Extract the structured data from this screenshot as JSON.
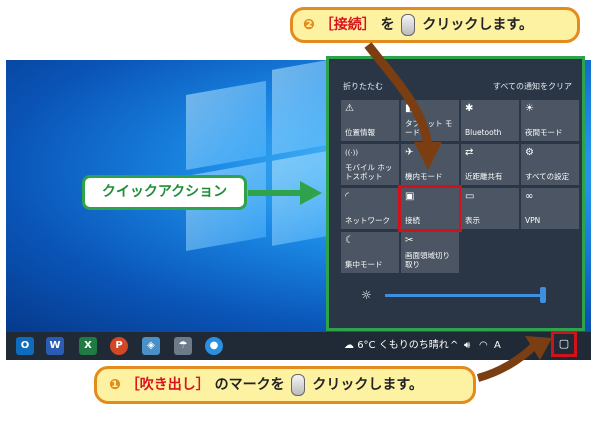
{
  "callout_top": {
    "number": "❷",
    "bracket": "［接続］",
    "text1": "を",
    "text2": "クリックします。"
  },
  "callout_bottom": {
    "number": "❶",
    "bracket": "［吹き出し］",
    "text1": "のマークを",
    "text2": "クリックします。"
  },
  "quick_action_label": "クイックアクション",
  "action_center": {
    "collapse": "折りたたむ",
    "clear_all": "すべての通知をクリア",
    "tiles": [
      {
        "icon": "⚠",
        "label": "位置情報"
      },
      {
        "icon": "◧",
        "label": "タブレット モード"
      },
      {
        "icon": "✱",
        "label": "Bluetooth"
      },
      {
        "icon": "☀",
        "label": "夜間モード"
      },
      {
        "icon": "((·))",
        "label": "モバイル ホットスポット"
      },
      {
        "icon": "✈",
        "label": "機内モード"
      },
      {
        "icon": "⇄",
        "label": "近距離共有"
      },
      {
        "icon": "⚙",
        "label": "すべての設定"
      },
      {
        "icon": "◜",
        "label": "ネットワーク"
      },
      {
        "icon": "▣",
        "label": "接続"
      },
      {
        "icon": "▭",
        "label": "表示"
      },
      {
        "icon": "∞",
        "label": "VPN"
      },
      {
        "icon": "☾",
        "label": "集中モード"
      },
      {
        "icon": "✂",
        "label": "画面領域切り取り"
      }
    ],
    "brightness_icon": "☼",
    "brightness_level": 1.0
  },
  "taskbar": {
    "apps": [
      {
        "name": "outlook",
        "glyph": "O",
        "color": "#0f6cbd"
      },
      {
        "name": "word",
        "glyph": "W",
        "color": "#2b5cb4"
      },
      {
        "name": "excel",
        "glyph": "X",
        "color": "#1f7a43"
      },
      {
        "name": "powerpoint",
        "glyph": "P",
        "color": "#d24726"
      },
      {
        "name": "app5",
        "glyph": "◈",
        "color": "#4a90c6"
      },
      {
        "name": "app6",
        "glyph": "☂",
        "color": "#6c7a8a"
      },
      {
        "name": "app7",
        "glyph": "●",
        "color": "#2b8fe0"
      }
    ],
    "weather": "6°C くもりのち晴れ",
    "tray_chevron": "^",
    "ime": "A"
  }
}
